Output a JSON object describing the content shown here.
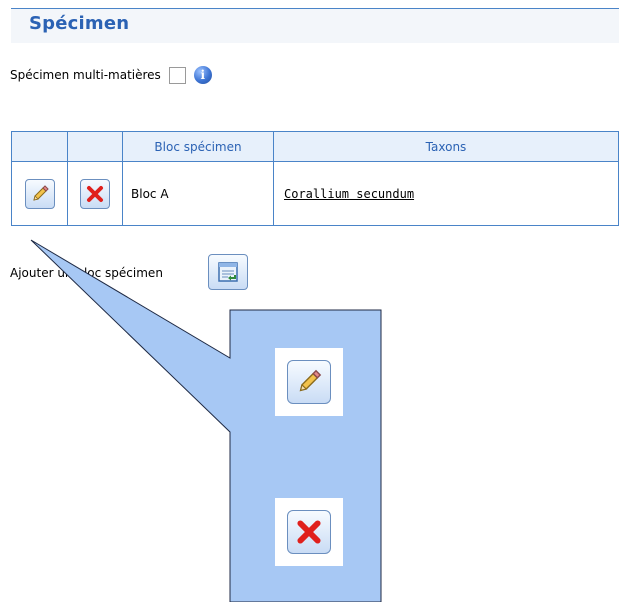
{
  "section": {
    "title": "Spécimen"
  },
  "multi": {
    "label": "Spécimen multi-matières",
    "checked": false,
    "info_glyph": "i"
  },
  "table": {
    "headers": [
      "",
      "",
      "Bloc spécimen",
      "Taxons"
    ],
    "rows": [
      {
        "bloc": "Bloc A",
        "taxon": "Corallium secundum"
      }
    ]
  },
  "add": {
    "label": "Ajouter un bloc spécimen"
  },
  "icons": {
    "edit": "pencil-edit-icon",
    "delete": "red-x-delete-icon",
    "add": "add-block-icon",
    "info": "info-icon"
  },
  "colors": {
    "accent": "#2b62b4",
    "border": "#4a84c8",
    "callout": "#a7c8f4",
    "delete_red": "#e0201c"
  }
}
